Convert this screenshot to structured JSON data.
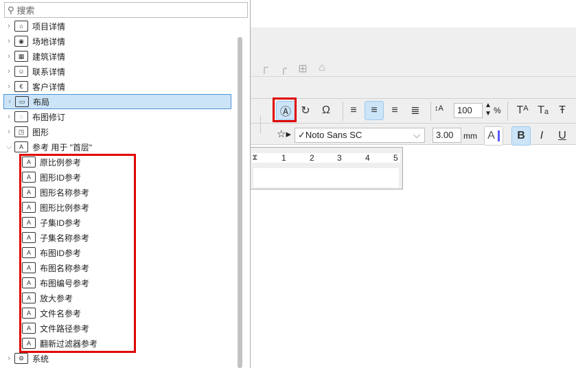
{
  "search": {
    "placeholder": "搜索"
  },
  "tree": [
    {
      "label": "项目详情",
      "icon": "house-icon"
    },
    {
      "label": "场地详情",
      "icon": "map-pin-icon"
    },
    {
      "label": "建筑详情",
      "icon": "building-icon"
    },
    {
      "label": "联系详情",
      "icon": "contact-icon"
    },
    {
      "label": "客户详情",
      "icon": "client-icon"
    },
    {
      "label": "布局",
      "icon": "layout-icon",
      "selected": true
    },
    {
      "label": "布图修订",
      "icon": "revision-icon"
    },
    {
      "label": "图形",
      "icon": "drawing-icon"
    },
    {
      "label": "参考 用于 \"首层\"",
      "icon": "reference-icon",
      "expanded": true
    }
  ],
  "children": [
    "原比例参考",
    "图形ID参考",
    "图形名称参考",
    "图形比例参考",
    "子集ID参考",
    "子集名称参考",
    "布图ID参考",
    "布图名称参考",
    "布图编号参考",
    "放大参考",
    "文件名参考",
    "文件路径参考",
    "翻新过滤器参考"
  ],
  "last": {
    "label": "系统",
    "icon": "system-icon"
  },
  "toolbar": {
    "line_spacing": "100",
    "percent": "%",
    "font": "✓Noto Sans SC",
    "size": "3.00",
    "unit": "mm",
    "color_label": "A",
    "bold": "B",
    "italic": "I",
    "underline": "U",
    "superscript": "Tᴬ",
    "subscript": "Tₐ",
    "strike": "Ŧ"
  },
  "ruler": {
    "ticks": [
      "1",
      "2",
      "3",
      "4",
      "5"
    ]
  },
  "colors": {
    "highlight": "#e00000",
    "selected": "#cce4f7"
  }
}
